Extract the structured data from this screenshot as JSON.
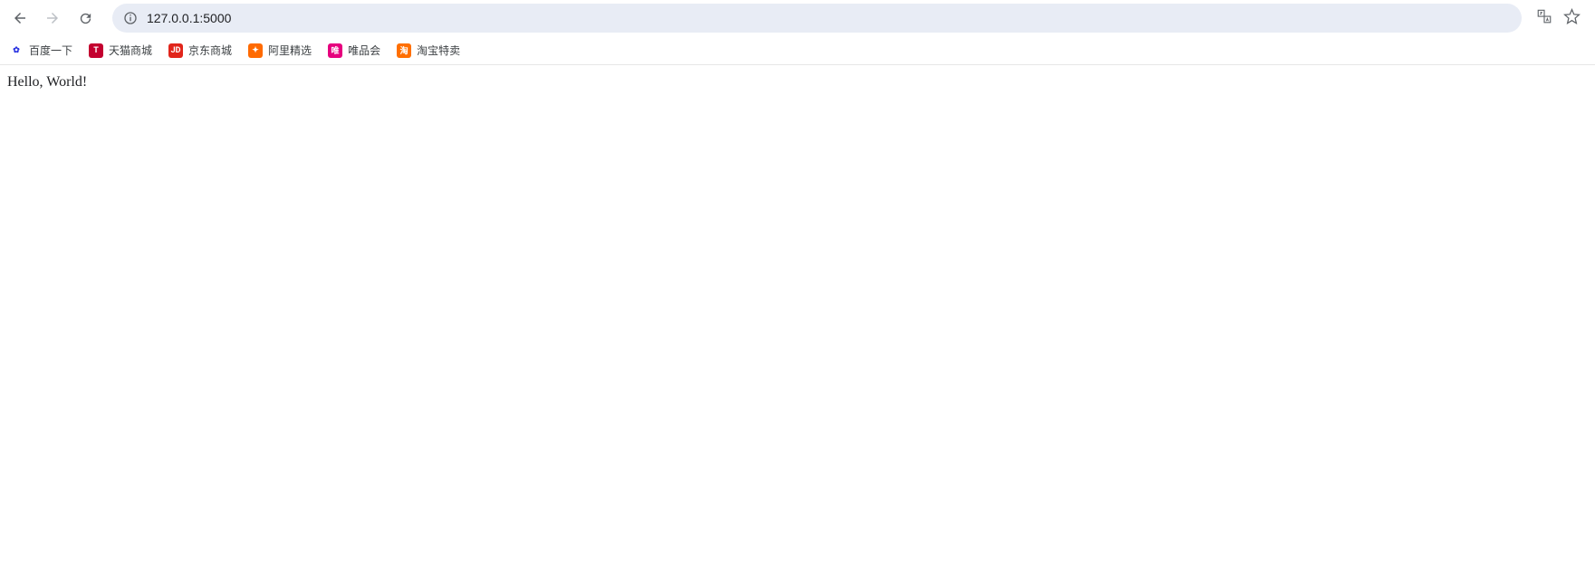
{
  "toolbar": {
    "url": "127.0.0.1:5000"
  },
  "bookmarks": [
    {
      "label": "百度一下",
      "icon_bg": "#ffffff",
      "icon_fg": "#2932e1",
      "icon_text": "✿"
    },
    {
      "label": "天猫商城",
      "icon_bg": "#c3002f",
      "icon_fg": "#ffffff",
      "icon_text": "T"
    },
    {
      "label": "京东商城",
      "icon_bg": "#e1251b",
      "icon_fg": "#ffffff",
      "icon_text": "JD"
    },
    {
      "label": "阿里精选",
      "icon_bg": "#ff6a00",
      "icon_fg": "#ffffff",
      "icon_text": "✦"
    },
    {
      "label": "唯品会",
      "icon_bg": "#e6007e",
      "icon_fg": "#ffffff",
      "icon_text": "唯"
    },
    {
      "label": "淘宝特卖",
      "icon_bg": "#ff6f00",
      "icon_fg": "#ffffff",
      "icon_text": "淘"
    }
  ],
  "page": {
    "body_text": "Hello, World!"
  }
}
